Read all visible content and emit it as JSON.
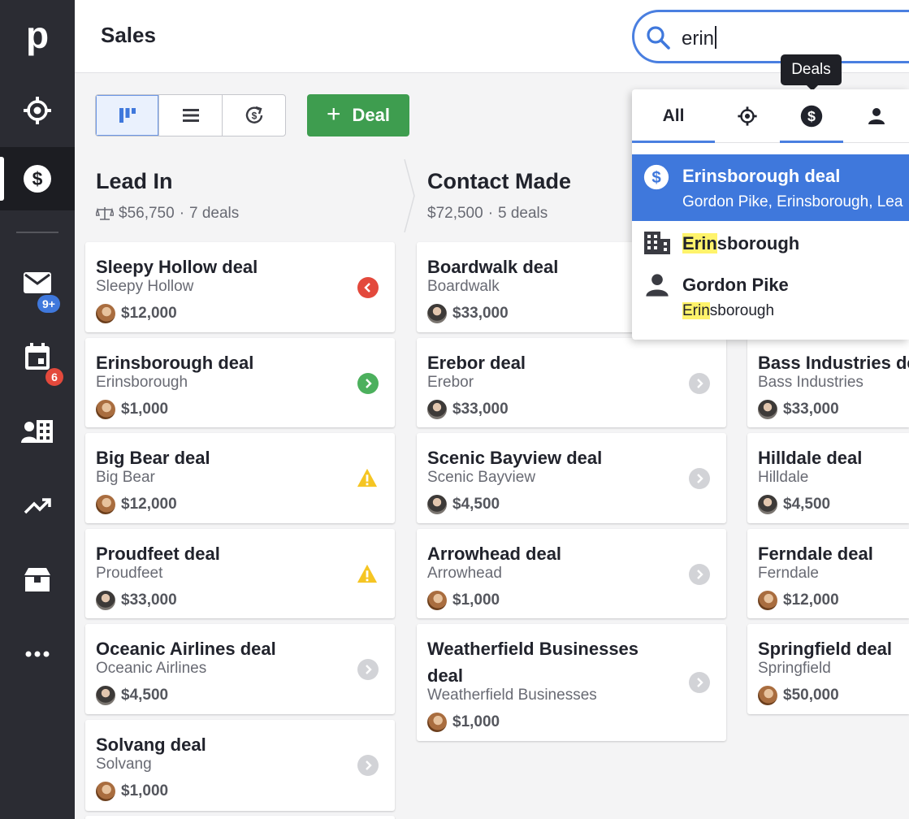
{
  "app": {
    "logo": "p",
    "page_title": "Sales"
  },
  "sidebar": {
    "items": [
      {
        "icon": "target-icon"
      },
      {
        "icon": "dollar-icon",
        "active": true
      },
      {
        "icon": "mail-icon",
        "badge": "9+",
        "badge_color": "#3f78dc"
      },
      {
        "icon": "calendar-icon",
        "badge": "6",
        "badge_color": "#e3493c"
      },
      {
        "icon": "contacts-icon"
      },
      {
        "icon": "trending-up-icon"
      },
      {
        "icon": "products-icon"
      },
      {
        "icon": "more-icon"
      }
    ]
  },
  "search": {
    "value": "erin"
  },
  "tooltip": {
    "text": "Deals"
  },
  "toolbar": {
    "add_label": "Deal",
    "add_plus": "+"
  },
  "columns": [
    {
      "title": "Lead In",
      "amount": "$56,750",
      "deals": "7 deals",
      "sep": "·"
    },
    {
      "title": "Contact Made",
      "amount": "$72,500",
      "deals": "5 deals",
      "sep": "·"
    }
  ],
  "cards_col1": [
    {
      "name": "Sleepy Hollow deal",
      "org": "Sleepy Hollow",
      "value": "$12,000",
      "status": "overdue"
    },
    {
      "name": "Erinsborough deal",
      "org": "Erinsborough",
      "value": "$1,000",
      "status": "scheduled"
    },
    {
      "name": "Big Bear deal",
      "org": "Big Bear",
      "value": "$12,000",
      "status": "warning"
    },
    {
      "name": "Proudfeet deal",
      "org": "Proudfeet",
      "value": "$33,000",
      "status": "warning"
    },
    {
      "name": "Oceanic Airlines deal",
      "org": "Oceanic Airlines",
      "value": "$4,500",
      "status": "none"
    },
    {
      "name": "Solvang deal",
      "org": "Solvang",
      "value": "$1,000",
      "status": "none"
    }
  ],
  "cards_col2": [
    {
      "name": "Boardwalk deal",
      "org": "Boardwalk",
      "value": "$33,000"
    },
    {
      "name": "Erebor deal",
      "org": "Erebor",
      "value": "$33,000",
      "status": "none"
    },
    {
      "name": "Scenic Bayview deal",
      "org": "Scenic Bayview",
      "value": "$4,500",
      "status": "none"
    },
    {
      "name": "Arrowhead deal",
      "org": "Arrowhead",
      "value": "$1,000",
      "status": "none"
    },
    {
      "name_line1": "Weatherfield Businesses",
      "name_line2": "deal",
      "org": "Weatherfield Businesses",
      "value": "$1,000",
      "status": "none"
    }
  ],
  "cards_col3": [
    {
      "name": "Bass Industries de",
      "org": "Bass Industries",
      "value": "$33,000"
    },
    {
      "name": "Hilldale deal",
      "org": "Hilldale",
      "value": "$4,500"
    },
    {
      "name": "Ferndale deal",
      "org": "Ferndale",
      "value": "$12,000"
    },
    {
      "name": "Springfield deal",
      "org": "Springfield",
      "value": "$50,000"
    }
  ],
  "search_results": {
    "tabs": [
      {
        "label": "All",
        "active": true
      },
      {
        "icon": "target-icon"
      },
      {
        "icon": "dollar-icon",
        "selected": true
      },
      {
        "icon": "person-icon"
      }
    ],
    "highlighted": {
      "title": "Erinsborough deal",
      "subtitle": "Gordon Pike, Erinsborough, Lea"
    },
    "org_result": {
      "match": "Erin",
      "rest": "sborough"
    },
    "person_result": {
      "name": "Gordon Pike",
      "org_match": "Erin",
      "org_rest": "sborough"
    }
  },
  "colors": {
    "accent": "#4a7fe0",
    "add_button": "#3e9d4f",
    "sidebar": "#2b2c33",
    "highlight": "#3f78dc"
  }
}
